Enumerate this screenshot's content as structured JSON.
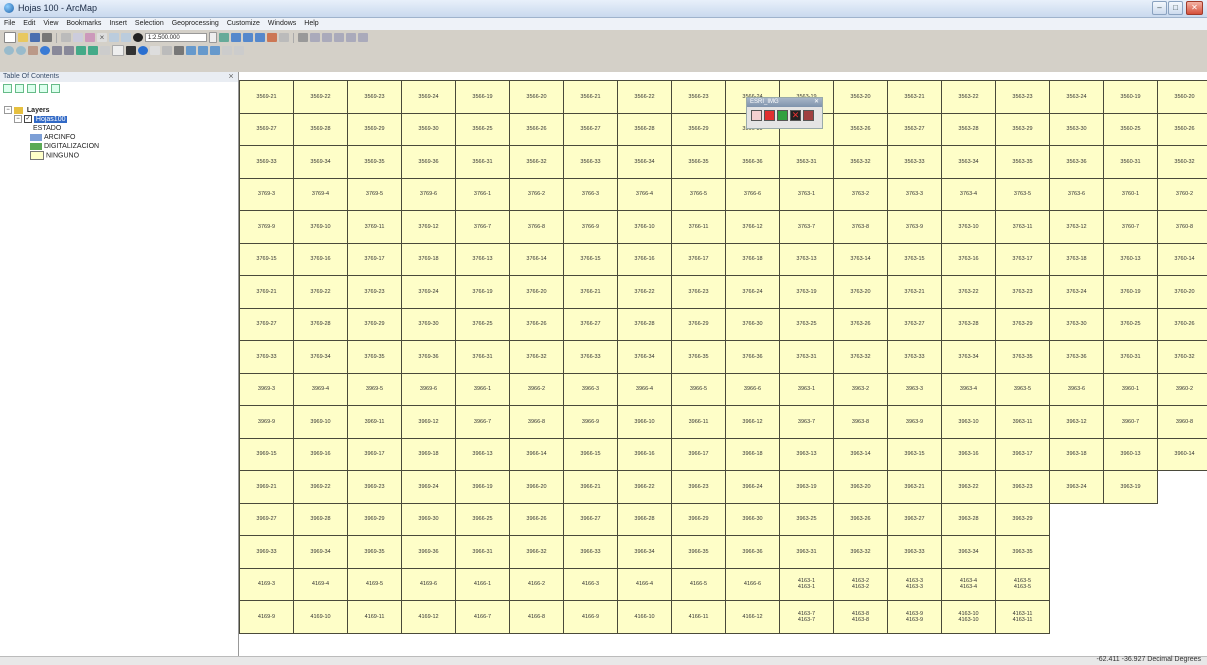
{
  "window": {
    "title": "Hojas 100 - ArcMap",
    "minimize": "–",
    "maximize": "□",
    "close": "✕"
  },
  "menu": [
    "File",
    "Edit",
    "View",
    "Bookmarks",
    "Insert",
    "Selection",
    "Geoprocessing",
    "Customize",
    "Windows",
    "Help"
  ],
  "toolbar": {
    "scale": "1:2.500.000"
  },
  "toc": {
    "title": "Table Of Contents",
    "close": "⨯",
    "layers_label": "Layers",
    "layer_name": "Hojas100",
    "field_name": "ESTADO",
    "legend": [
      {
        "label": "ARCINFO",
        "color": "#7d9fd6"
      },
      {
        "label": "DIGITALIZACION",
        "color": "#5aaa55"
      },
      {
        "label": "NINGUNO",
        "color": "#fefec8"
      }
    ]
  },
  "floating_toolbar": {
    "title": "ESRI_IMG",
    "close": "✕"
  },
  "status": {
    "coordinates": "-62.411  -36.927 Decimal Degrees"
  },
  "map_grid": [
    [
      "3569-21",
      "3569-22",
      "3569-23",
      "3569-24",
      "3566-19",
      "3566-20",
      "3566-21",
      "3566-22",
      "3566-23",
      "3566-24",
      "3563-19",
      "3563-20",
      "3563-21",
      "3563-22",
      "3563-23",
      "3563-24",
      "3560-19",
      "3560-20",
      "3560-21"
    ],
    [
      "3569-27",
      "3569-28",
      "3569-29",
      "3569-30",
      "3566-25",
      "3566-26",
      "3566-27",
      "3566-28",
      "3566-29",
      "3566-30",
      "",
      "3563-26",
      "3563-27",
      "3563-28",
      "3563-29",
      "3563-30",
      "3560-25",
      "3560-26",
      "3560-27"
    ],
    [
      "3569-33",
      "3569-34",
      "3569-35",
      "3569-36",
      "3566-31",
      "3566-32",
      "3566-33",
      "3566-34",
      "3566-35",
      "3566-36",
      "3563-31",
      "3563-32",
      "3563-33",
      "3563-34",
      "3563-35",
      "3563-36",
      "3560-31",
      "3560-32",
      "3560-33"
    ],
    [
      "3769-3",
      "3769-4",
      "3769-5",
      "3769-6",
      "3766-1",
      "3766-2",
      "3766-3",
      "3766-4",
      "3766-5",
      "3766-6",
      "3763-1",
      "3763-2",
      "3763-3",
      "3763-4",
      "3763-5",
      "3763-6",
      "3760-1",
      "3760-2",
      "3760-3"
    ],
    [
      "3769-9",
      "3769-10",
      "3769-11",
      "3769-12",
      "3766-7",
      "3766-8",
      "3766-9",
      "3766-10",
      "3766-11",
      "3766-12",
      "3763-7",
      "3763-8",
      "3763-9",
      "3763-10",
      "3763-11",
      "3763-12",
      "3760-7",
      "3760-8",
      "3760-9"
    ],
    [
      "3769-15",
      "3769-16",
      "3769-17",
      "3769-18",
      "3766-13",
      "3766-14",
      "3766-15",
      "3766-16",
      "3766-17",
      "3766-18",
      "3763-13",
      "3763-14",
      "3763-15",
      "3763-16",
      "3763-17",
      "3763-18",
      "3760-13",
      "3760-14",
      "3760-15"
    ],
    [
      "3769-21",
      "3769-22",
      "3769-23",
      "3769-24",
      "3766-19",
      "3766-20",
      "3766-21",
      "3766-22",
      "3766-23",
      "3766-24",
      "3763-19",
      "3763-20",
      "3763-21",
      "3763-22",
      "3763-23",
      "3763-24",
      "3760-19",
      "3760-20",
      "3760-21"
    ],
    [
      "3769-27",
      "3769-28",
      "3769-29",
      "3769-30",
      "3766-25",
      "3766-26",
      "3766-27",
      "3766-28",
      "3766-29",
      "3766-30",
      "3763-25",
      "3763-26",
      "3763-27",
      "3763-28",
      "3763-29",
      "3763-30",
      "3760-25",
      "3760-26",
      "3760-27"
    ],
    [
      "3769-33",
      "3769-34",
      "3769-35",
      "3769-36",
      "3766-31",
      "3766-32",
      "3766-33",
      "3766-34",
      "3766-35",
      "3766-36",
      "3763-31",
      "3763-32",
      "3763-33",
      "3763-34",
      "3763-35",
      "3763-36",
      "3760-31",
      "3760-32",
      "3760-33"
    ],
    [
      "3969-3",
      "3969-4",
      "3969-5",
      "3969-6",
      "3966-1",
      "3966-2",
      "3966-3",
      "3966-4",
      "3966-5",
      "3966-6",
      "3963-1",
      "3963-2",
      "3963-3",
      "3963-4",
      "3963-5",
      "3963-6",
      "3960-1",
      "3960-2",
      "3960-3"
    ],
    [
      "3969-9",
      "3969-10",
      "3969-11",
      "3969-12",
      "3966-7",
      "3966-8",
      "3966-9",
      "3966-10",
      "3966-11",
      "3966-12",
      "3963-7",
      "3963-8",
      "3963-9",
      "3963-10",
      "3963-11",
      "3963-12",
      "3960-7",
      "3960-8",
      "3960-9"
    ],
    [
      "3969-15",
      "3969-16",
      "3969-17",
      "3969-18",
      "3966-13",
      "3966-14",
      "3966-15",
      "3966-16",
      "3966-17",
      "3966-18",
      "3963-13",
      "3963-14",
      "3963-15",
      "3963-16",
      "3963-17",
      "3963-18",
      "3960-13",
      "3960-14",
      "3960-15"
    ],
    [
      "3969-21",
      "3969-22",
      "3969-23",
      "3969-24",
      "3966-19",
      "3966-20",
      "3966-21",
      "3966-22",
      "3966-23",
      "3966-24",
      "3963-19",
      "3963-20",
      "3963-21",
      "3963-22",
      "3963-23",
      "3963-24",
      "3963-19"
    ],
    [
      "3969-27",
      "3969-28",
      "3969-29",
      "3969-30",
      "3966-25",
      "3966-26",
      "3966-27",
      "3966-28",
      "3966-29",
      "3966-30",
      "3963-25",
      "3963-26",
      "3963-27",
      "3963-28",
      "3963-29"
    ],
    [
      "3969-33",
      "3969-34",
      "3969-35",
      "3969-36",
      "3966-31",
      "3966-32",
      "3966-33",
      "3966-34",
      "3966-35",
      "3966-36",
      "3963-31",
      "3963-32",
      "3963-33",
      "3963-34",
      "3963-35"
    ],
    [
      "4169-3",
      "4169-4",
      "4169-5",
      "4169-6",
      "4166-1",
      "4166-2",
      "4166-3",
      "4166-4",
      "4166-5",
      "4166-6",
      "4163-1\n4163-1",
      "4163-2\n4163-2",
      "4163-3\n4163-3",
      "4163-4\n4163-4",
      "4163-5\n4163-5"
    ],
    [
      "4169-9",
      "4169-10",
      "4169-11",
      "4169-12",
      "4166-7",
      "4166-8",
      "4166-9",
      "4166-10",
      "4166-11",
      "4166-12",
      "4163-7\n4163-7",
      "4163-8\n4163-8",
      "4163-9\n4163-9",
      "4163-10\n4163-10",
      "4163-11\n4163-11"
    ]
  ]
}
